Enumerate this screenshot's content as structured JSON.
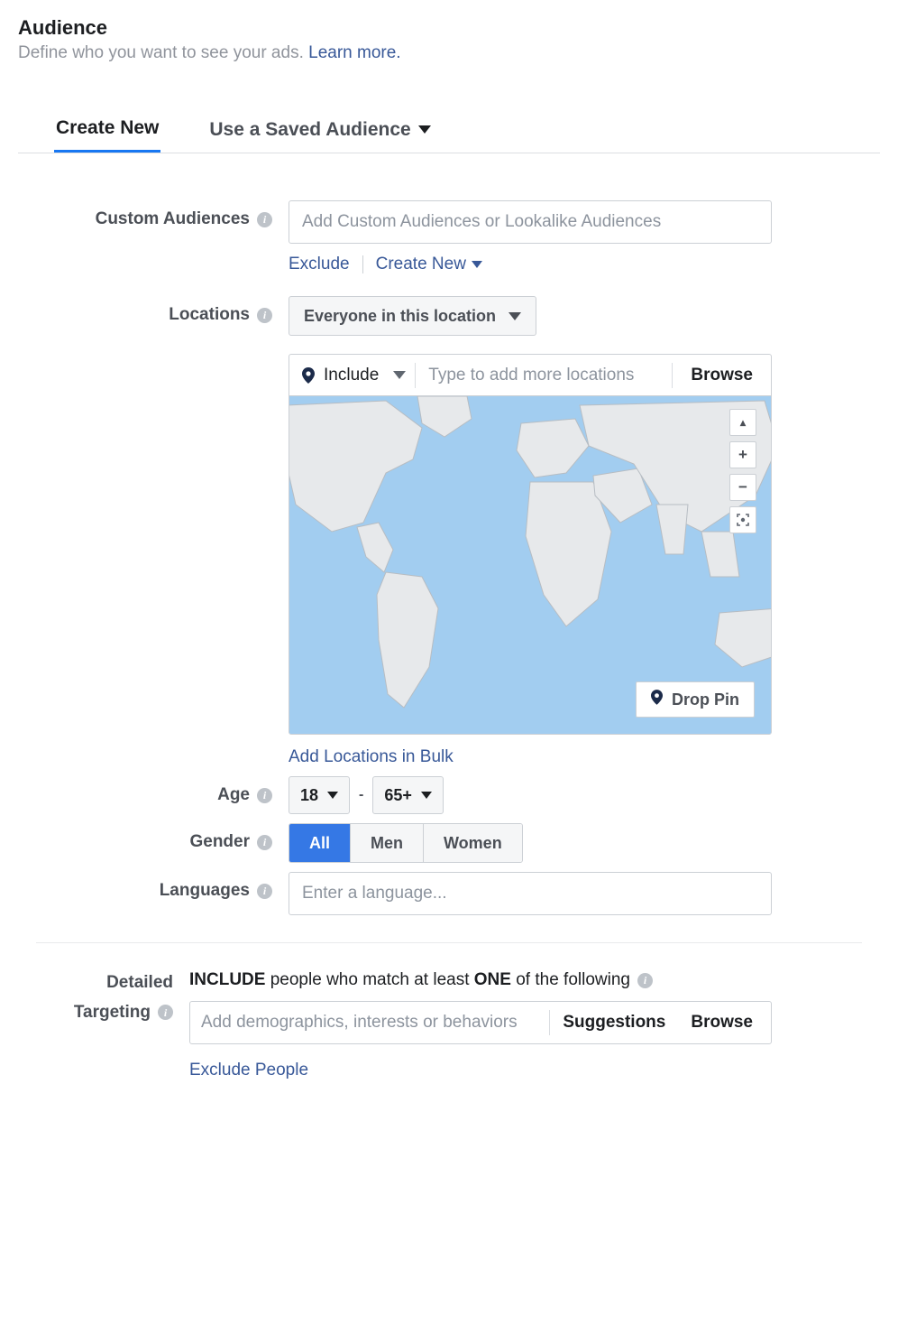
{
  "header": {
    "title": "Audience",
    "subtitle_prefix": "Define who you want to see your ads. ",
    "learn_more": "Learn more."
  },
  "tabs": {
    "create_new": "Create New",
    "saved": "Use a Saved Audience"
  },
  "custom_audiences": {
    "label": "Custom Audiences",
    "placeholder": "Add Custom Audiences or Lookalike Audiences",
    "exclude": "Exclude",
    "create_new": "Create New"
  },
  "locations": {
    "label": "Locations",
    "scope": "Everyone in this location",
    "include": "Include",
    "placeholder": "Type to add more locations",
    "browse": "Browse",
    "drop_pin": "Drop Pin",
    "bulk": "Add Locations in Bulk"
  },
  "age": {
    "label": "Age",
    "min": "18",
    "max": "65+"
  },
  "gender": {
    "label": "Gender",
    "options": {
      "all": "All",
      "men": "Men",
      "women": "Women"
    },
    "selected": "all"
  },
  "languages": {
    "label": "Languages",
    "placeholder": "Enter a language..."
  },
  "detailed": {
    "label_line1": "Detailed",
    "label_line2": "Targeting",
    "title_pre": "INCLUDE",
    "title_mid": " people who match at least ",
    "title_one": "ONE",
    "title_post": " of the following",
    "placeholder": "Add demographics, interests or behaviors",
    "suggestions": "Suggestions",
    "browse": "Browse",
    "exclude": "Exclude People"
  }
}
